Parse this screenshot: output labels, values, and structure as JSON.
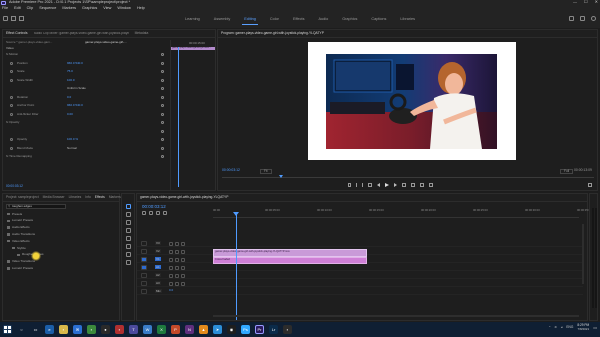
{
  "titlebar": {
    "title": "Adobe Premiere Pro 2021 - D:\\0.1 Projects 1\\SP\\sampleproject\\project *",
    "min": "—",
    "max": "☐",
    "close": "✕"
  },
  "menu": [
    "File",
    "Edit",
    "Clip",
    "Sequence",
    "Markers",
    "Graphics",
    "View",
    "Window",
    "Help"
  ],
  "workspaces": [
    "Learning",
    "Assembly",
    "Editing",
    "Color",
    "Effects",
    "Audio",
    "Graphics",
    "Captions",
    "Libraries"
  ],
  "effect_controls": {
    "tabs": [
      "Effect Controls",
      "Audio Clip Mixer: gamer-plays-video-game-girl-with-joystick-playing-YLQATYP",
      "Metadata"
    ],
    "source_label": "Source * gamer-plays-video-gam...",
    "sequence_label": "gamer-plays-video-game-girl-...",
    "section_video": "Video",
    "rows": [
      {
        "label": "fx  Motion",
        "value": ""
      },
      {
        "label": "Position",
        "value": "960.0    540.0"
      },
      {
        "label": "Scale",
        "value": "75.0"
      },
      {
        "label": "Scale Width",
        "value": "100.0"
      },
      {
        "label": "",
        "value": "Uniform Scale"
      },
      {
        "label": "Rotation",
        "value": "0.0"
      },
      {
        "label": "Anchor Point",
        "value": "960.0    540.0"
      },
      {
        "label": "Anti-flicker Filter",
        "value": "0.00"
      },
      {
        "label": "fx  Opacity",
        "value": ""
      },
      {
        "label": "",
        "value": ""
      },
      {
        "label": "Opacity",
        "value": "100.0 %"
      },
      {
        "label": "Blend Mode",
        "value": "Normal"
      },
      {
        "label": "fx  Time Remapping",
        "value": ""
      }
    ],
    "mini_tl_time": "00:00:15:00",
    "mini_clip": "gamer-plays-video-game-girl-with...",
    "timecode": "00:00:03:12"
  },
  "program": {
    "tab": "Program: gamer-plays-video-game-girl-with-joystick-playing-YLQATYP",
    "timecode_left": "00:00:03:12",
    "fit": "Fit",
    "quality": "Full",
    "timecode_right": "00:00:13:09"
  },
  "project": {
    "tabs": [
      "Project: sampleproject",
      "Media Browser",
      "Libraries",
      "Info",
      "Effects",
      "Markers",
      "Hist"
    ],
    "search": "toughen edges",
    "tree": [
      {
        "label": "Presets",
        "indent": 0
      },
      {
        "label": "Lumetri Presets",
        "indent": 0
      },
      {
        "label": "Audio Effects",
        "indent": 0
      },
      {
        "label": "Audio Transitions",
        "indent": 0
      },
      {
        "label": "Video Effects",
        "indent": 0
      },
      {
        "label": "Stylize",
        "indent": 1
      },
      {
        "label": "Roughen Edges",
        "indent": 2
      },
      {
        "label": "Video Transitions",
        "indent": 0
      },
      {
        "label": "Lumetri Presets",
        "indent": 0
      }
    ]
  },
  "timeline": {
    "tab": "gamer-plays-video-game-girl-with-joystick-playing-YLQATYP",
    "timecode": "00:00:03:12",
    "ruler": [
      "00:00",
      "00:00:05:00",
      "00:00:10:00",
      "00:00:15:00",
      "00:00:20:00",
      "00:00:25:00",
      "00:00:30:00",
      "00:00:35:00"
    ],
    "tracks": [
      "V3",
      "V2",
      "V1",
      "A1",
      "A2",
      "A3",
      "Mix"
    ],
    "clip_v": "gamer-plays-video-game-girl-with-joystick-playing-YLQATYP.mov",
    "clip_a": "Cross Faded",
    "mix_val": "0.0"
  },
  "taskbar": {
    "lang": "ENG",
    "time": "8:29 PM",
    "date": "7/8/2021"
  },
  "colors": {
    "accent": "#4f9bff",
    "video_clip": "#c99ad8",
    "audio_clip": "#cf7fd6",
    "playhead": "#4f9bff"
  }
}
